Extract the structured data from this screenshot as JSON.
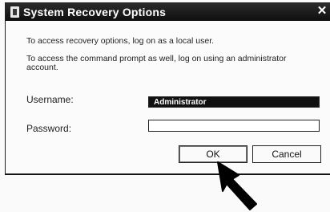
{
  "window": {
    "title": "System Recovery Options",
    "close_glyph": "✕"
  },
  "intro": {
    "line1": "To access recovery options, log on as a local user.",
    "line2": "To access the command prompt as well, log on using an administrator account."
  },
  "form": {
    "username_label": "Username:",
    "username_value": "Administrator",
    "password_label": "Password:",
    "password_value": ""
  },
  "buttons": {
    "ok_label": "OK",
    "cancel_label": "Cancel"
  },
  "icons": {
    "title": "recovery-window-icon",
    "close": "close-icon",
    "pointer": "mouse-pointer-icon"
  }
}
